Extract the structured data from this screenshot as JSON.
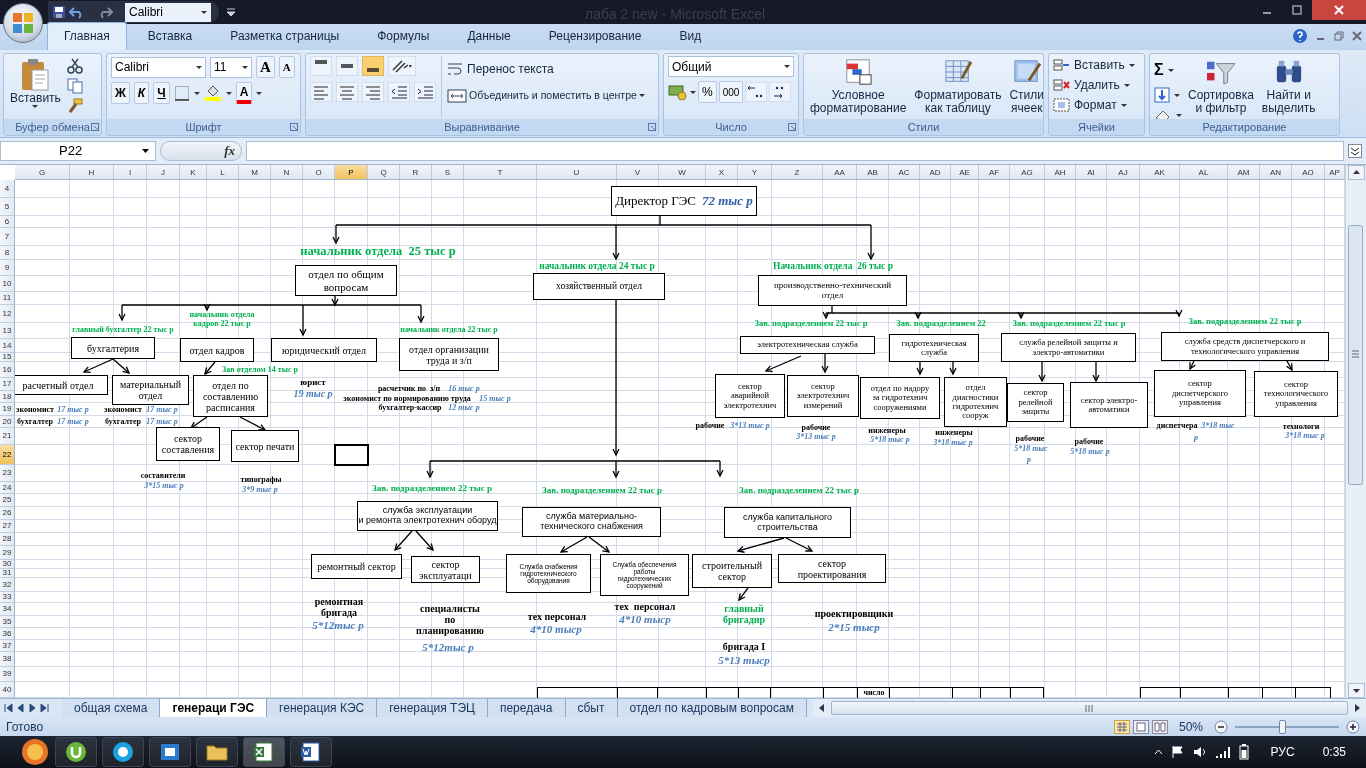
{
  "title_bar": {
    "font_box": "Calibri",
    "title": "лаба 2 new  -  Microsoft Excel"
  },
  "ribbon": {
    "tabs": [
      {
        "label": "Главная",
        "selected": true
      },
      {
        "label": "Вставка",
        "selected": false
      },
      {
        "label": "Разметка страницы",
        "selected": false
      },
      {
        "label": "Формулы",
        "selected": false
      },
      {
        "label": "Данные",
        "selected": false
      },
      {
        "label": "Рецензирование",
        "selected": false
      },
      {
        "label": "Вид",
        "selected": false
      }
    ],
    "clipboard": {
      "paste": "Вставить",
      "group": "Буфер обмена"
    },
    "font": {
      "name": "Calibri",
      "size": "11",
      "grow": "A",
      "shrink": "A",
      "bold": "Ж",
      "italic": "К",
      "underline": "Ч",
      "color_letter": "A",
      "group": "Шрифт"
    },
    "alignment": {
      "vertical_buttons": [
        {
          "selected": false
        },
        {
          "selected": false
        },
        {
          "selected": true
        }
      ],
      "wrap": "Перенос текста",
      "merge": "Объединить и поместить в центре",
      "group": "Выравнивание"
    },
    "number": {
      "format": "Общий",
      "percent": "%",
      "thousands": "000",
      "group": "Число"
    },
    "styles": {
      "buttons": [
        "Условное\nформатирование",
        "Форматировать\nкак таблицу",
        "Стили\nячеек"
      ],
      "group": "Стили"
    },
    "cells": {
      "buttons": [
        "Вставить",
        "Удалить",
        "Формат"
      ],
      "group": "Ячейки"
    },
    "editing": {
      "sum": "Σ",
      "buttons": [
        "Сортировка\nи фильтр",
        "Найти и\nвыделить"
      ],
      "group": "Редактирование"
    }
  },
  "formula_bar": {
    "name_box": "P22",
    "fx": "fx"
  },
  "sheet": {
    "columns": [
      {
        "label": "G",
        "selected": false
      },
      {
        "label": "H",
        "selected": false
      },
      {
        "label": "I",
        "selected": false
      },
      {
        "label": "J",
        "selected": false
      },
      {
        "label": "K",
        "selected": false
      },
      {
        "label": "L",
        "selected": false
      },
      {
        "label": "M",
        "selected": false
      },
      {
        "label": "N",
        "selected": false
      },
      {
        "label": "O",
        "selected": false
      },
      {
        "label": "P",
        "selected": true
      },
      {
        "label": "Q",
        "selected": false
      },
      {
        "label": "R",
        "selected": false
      },
      {
        "label": "S",
        "selected": false
      },
      {
        "label": "T",
        "selected": false
      },
      {
        "label": "U",
        "selected": false
      },
      {
        "label": "V",
        "selected": false
      },
      {
        "label": "W",
        "selected": false
      },
      {
        "label": "X",
        "selected": false
      },
      {
        "label": "Y",
        "selected": false
      },
      {
        "label": "Z",
        "selected": false
      },
      {
        "label": "AA",
        "selected": false
      },
      {
        "label": "AB",
        "selected": false
      },
      {
        "label": "AC",
        "selected": false
      },
      {
        "label": "AD",
        "selected": false
      },
      {
        "label": "AE",
        "selected": false
      },
      {
        "label": "AF",
        "selected": false
      },
      {
        "label": "AG",
        "selected": false
      },
      {
        "label": "AH",
        "selected": false
      },
      {
        "label": "AI",
        "selected": false
      },
      {
        "label": "AJ",
        "selected": false
      },
      {
        "label": "AK",
        "selected": false
      },
      {
        "label": "AL",
        "selected": false
      },
      {
        "label": "AM",
        "selected": false
      },
      {
        "label": "AN",
        "selected": false
      },
      {
        "label": "AO",
        "selected": false
      },
      {
        "label": "AP",
        "selected": false
      }
    ],
    "rows": [
      {
        "label": "4",
        "selected": false
      },
      {
        "label": "5",
        "selected": false
      },
      {
        "label": "6",
        "selected": false
      },
      {
        "label": "7",
        "selected": false
      },
      {
        "label": "8",
        "selected": false
      },
      {
        "label": "9",
        "selected": false
      },
      {
        "label": "10",
        "selected": false
      },
      {
        "label": "11",
        "selected": false
      },
      {
        "label": "12",
        "selected": false
      },
      {
        "label": "13",
        "selected": false
      },
      {
        "label": "14",
        "selected": false
      },
      {
        "label": "15",
        "selected": false
      },
      {
        "label": "16",
        "selected": false
      },
      {
        "label": "17",
        "selected": false
      },
      {
        "label": "18",
        "selected": false
      },
      {
        "label": "19",
        "selected": false
      },
      {
        "label": "20",
        "selected": false
      },
      {
        "label": "21",
        "selected": false
      },
      {
        "label": "22",
        "selected": true
      },
      {
        "label": "23",
        "selected": false
      },
      {
        "label": "24",
        "selected": false
      },
      {
        "label": "25",
        "selected": false
      },
      {
        "label": "26",
        "selected": false
      },
      {
        "label": "27",
        "selected": false
      },
      {
        "label": "28",
        "selected": false
      },
      {
        "label": "29",
        "selected": false
      },
      {
        "label": "30",
        "selected": false
      },
      {
        "label": "31",
        "selected": false
      },
      {
        "label": "32",
        "selected": false
      },
      {
        "label": "33",
        "selected": false
      },
      {
        "label": "34",
        "selected": false
      },
      {
        "label": "35",
        "selected": false
      },
      {
        "label": "36",
        "selected": false
      },
      {
        "label": "37",
        "selected": false
      },
      {
        "label": "38",
        "selected": false
      },
      {
        "label": "39",
        "selected": false
      },
      {
        "label": "40",
        "selected": false
      }
    ],
    "org_chart": [
      {
        "kind": "box",
        "text": "Директор ГЭС",
        "salary": "72 тыс р"
      },
      {
        "kind": "manager",
        "text": "начальник отдела  25 тыс р"
      },
      {
        "kind": "manager",
        "text": "начальник отдела 24 тыс р"
      },
      {
        "kind": "manager",
        "text": "Начальник отдела  26 тыс р"
      },
      {
        "kind": "box",
        "text": "отдел по общим\nвопросам"
      },
      {
        "kind": "box",
        "text": "хозяйственный отдел"
      },
      {
        "kind": "box",
        "text": "производственно-технический\nотдел"
      },
      {
        "kind": "manager",
        "text": "главный бухгалтер 22 тыс р"
      },
      {
        "kind": "manager",
        "text": "начальник отдела\nкадров 22 тыс р"
      },
      {
        "kind": "manager",
        "text": "начальник отдела 22 тыс р"
      },
      {
        "kind": "manager",
        "text": "Зав. подразделением 22 тыс р"
      },
      {
        "kind": "manager",
        "text": "Зав. подразделением 22"
      },
      {
        "kind": "manager",
        "text": "Зав. подразделением 22 тыс р"
      },
      {
        "kind": "manager",
        "text": "Зав. подразделением 22 тыс р"
      },
      {
        "kind": "box",
        "text": "бухгалтерия"
      },
      {
        "kind": "box",
        "text": "отдел кадров"
      },
      {
        "kind": "box",
        "text": "юридический отдел"
      },
      {
        "kind": "box",
        "text": "отдел организации\nтруда и з/п"
      },
      {
        "kind": "box",
        "text": "электротехническая служба"
      },
      {
        "kind": "box",
        "text": "гидротехническая\nслужба"
      },
      {
        "kind": "box",
        "text": "служба релейной защиты и\nэлектро-автоматики"
      },
      {
        "kind": "box",
        "text": "служба средств диспетчерского и\nтехнологического управления"
      },
      {
        "kind": "manager",
        "text": "Зав отделом 14 тыс р"
      },
      {
        "kind": "box",
        "text": "расчетный отдел"
      },
      {
        "kind": "box",
        "text": "материальный\nотдел"
      },
      {
        "kind": "box",
        "text": "отдел по\nсоставлению\nрасписания"
      },
      {
        "kind": "staff",
        "text": "юрист"
      },
      {
        "kind": "staff",
        "text": "расчетчик по  з/п"
      },
      {
        "kind": "salary",
        "text": "16 тыс р"
      },
      {
        "kind": "salary",
        "text": "19 тыс р"
      },
      {
        "kind": "staff",
        "text": "экономист по нормированию труда"
      },
      {
        "kind": "salary",
        "text": "15 тыс р"
      },
      {
        "kind": "staff",
        "text": "экономист"
      },
      {
        "kind": "salary",
        "text": "17 тыс р"
      },
      {
        "kind": "staff",
        "text": "экономист"
      },
      {
        "kind": "salary",
        "text": "17 тыс р"
      },
      {
        "kind": "staff",
        "text": "бухгалтер-кассир"
      },
      {
        "kind": "salary",
        "text": "12 тыс р"
      },
      {
        "kind": "staff",
        "text": "бухгалтер"
      },
      {
        "kind": "salary",
        "text": "17 тыс р"
      },
      {
        "kind": "staff",
        "text": "бухгалтер"
      },
      {
        "kind": "salary",
        "text": "17 тыс р"
      },
      {
        "kind": "box",
        "text": "сектор\nаварийной\nэлектротехнич"
      },
      {
        "kind": "box",
        "text": "сектор\nэлектротехнич\nизмерений"
      },
      {
        "kind": "box",
        "text": "отдел по надору\nза  гидротехнич\nсооружениями"
      },
      {
        "kind": "box",
        "text": "отдел\nдиагностики\nгидротехнич\nсооруж"
      },
      {
        "kind": "box",
        "text": "сектор\nрелейной\nзащиты"
      },
      {
        "kind": "box",
        "text": "сектор электро-\nавтоматики"
      },
      {
        "kind": "box",
        "text": "сектор\nдиспетчерского\nуправления"
      },
      {
        "kind": "box",
        "text": "сектор\nтехнологического\nуправления"
      },
      {
        "kind": "box",
        "text": "сектор\nсоставления"
      },
      {
        "kind": "box",
        "text": "сектор печати"
      },
      {
        "kind": "staff",
        "text": "рабочие"
      },
      {
        "kind": "salary",
        "text": "3*13 тыс р"
      },
      {
        "kind": "staff",
        "text": "рабочие"
      },
      {
        "kind": "staff",
        "text": "инженеры"
      },
      {
        "kind": "staff",
        "text": "инженеры"
      },
      {
        "kind": "staff",
        "text": "диспетчера"
      },
      {
        "kind": "salary",
        "text": "3*18 тыс"
      },
      {
        "kind": "staff",
        "text": "технологи"
      },
      {
        "kind": "salary",
        "text": "3*13 тыс р"
      },
      {
        "kind": "salary",
        "text": "5*18 тыс р"
      },
      {
        "kind": "salary",
        "text": "3*18 тыс р"
      },
      {
        "kind": "staff",
        "text": "рабочие"
      },
      {
        "kind": "staff",
        "text": "рабочие"
      },
      {
        "kind": "salary",
        "text": "р"
      },
      {
        "kind": "salary",
        "text": "3*18 тыс р"
      },
      {
        "kind": "salary",
        "text": "5*18 тыс"
      },
      {
        "kind": "salary",
        "text": "5*18 тыс р"
      },
      {
        "kind": "salary",
        "text": "р"
      },
      {
        "kind": "staff",
        "text": "составители"
      },
      {
        "kind": "staff",
        "text": "типографы"
      },
      {
        "kind": "salary",
        "text": "3*15 тыс р"
      },
      {
        "kind": "salary",
        "text": "3*9 тыс р"
      },
      {
        "kind": "manager",
        "text": "Зав. подразделением 22 тыс р"
      },
      {
        "kind": "manager",
        "text": "Зав. подразделением 22 тыс р"
      },
      {
        "kind": "manager",
        "text": "Зав. подразделением 22 тыс р"
      },
      {
        "kind": "box",
        "text": "служба эксплуатации\nи ремонта электротехнич оборуд"
      },
      {
        "kind": "box",
        "text": "служба материально-\nтехнического  снабжения"
      },
      {
        "kind": "box",
        "text": "служба капитального\nстроительства"
      },
      {
        "kind": "box",
        "text": "ремонтный сектор"
      },
      {
        "kind": "box",
        "text": "сектор\nэксплуатаци"
      },
      {
        "kind": "box",
        "text": "Служба снабжения\nгидротехнического\nоборудования"
      },
      {
        "kind": "box",
        "text": "Служба обеспечения\nработы\nгидротехнических\nсооружений"
      },
      {
        "kind": "box",
        "text": "строительный\nсектор"
      },
      {
        "kind": "box",
        "text": "сектор\nпроектирования"
      },
      {
        "kind": "staff",
        "text": "ремонтная\nбригада"
      },
      {
        "kind": "salary",
        "text": "5*12тыс р"
      },
      {
        "kind": "staff",
        "text": "специалисты\nпо\nпланированию"
      },
      {
        "kind": "staff",
        "text": "тех персонал"
      },
      {
        "kind": "staff",
        "text": "тех  персонал"
      },
      {
        "kind": "salary",
        "text": "4*10 тыср"
      },
      {
        "kind": "salary",
        "text": "4*10 тыср"
      },
      {
        "kind": "manager",
        "text": "главный\nбригадир"
      },
      {
        "kind": "staff",
        "text": "проектировщики"
      },
      {
        "kind": "salary",
        "text": "2*15 тыср"
      },
      {
        "kind": "salary",
        "text": "5*12тыс р"
      },
      {
        "kind": "staff",
        "text": "бригада I"
      },
      {
        "kind": "salary",
        "text": "5*13 тыср"
      },
      {
        "kind": "staff",
        "text": "число"
      }
    ]
  },
  "sheet_tabs": [
    {
      "label": "общая схема",
      "selected": false
    },
    {
      "label": "генераци ГЭС",
      "selected": true
    },
    {
      "label": "генерация КЭС",
      "selected": false
    },
    {
      "label": "генерация ТЭЦ",
      "selected": false
    },
    {
      "label": "передача",
      "selected": false
    },
    {
      "label": "сбыт",
      "selected": false
    },
    {
      "label": "отдел по кадровым вопросам",
      "selected": false
    }
  ],
  "status_bar": {
    "text": "Готово",
    "zoom": "50%",
    "level": 0.45
  },
  "taskbar": {
    "language": "РУС",
    "time": "0:35"
  }
}
